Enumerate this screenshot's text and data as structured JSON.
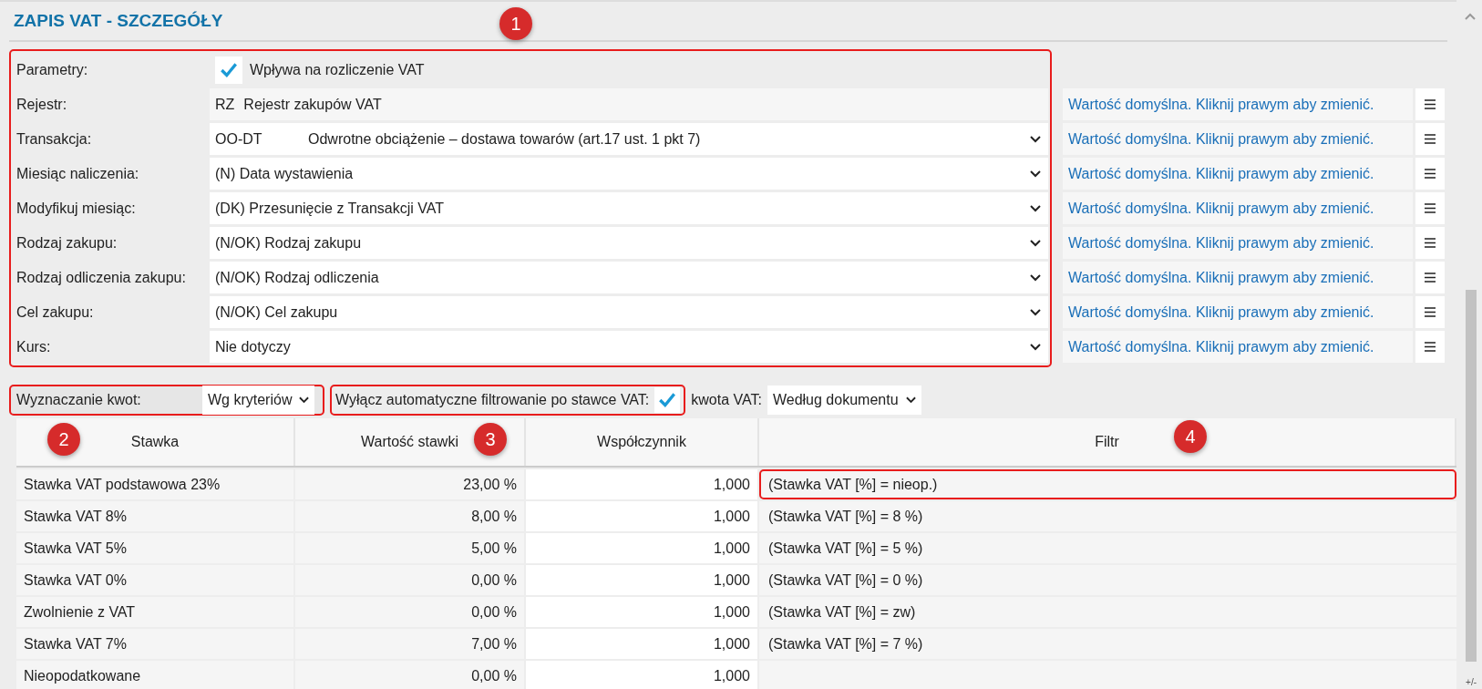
{
  "title": "ZAPIS VAT - SZCZEGÓŁY",
  "form": {
    "highlighted": true,
    "badge": "1",
    "rows": [
      {
        "kind": "checkbox",
        "label": "Parametry:",
        "checked": true,
        "text": "Wpływa na rozliczenie VAT"
      },
      {
        "kind": "static",
        "label": "Rejestr:",
        "code": "RZ",
        "text": "Rejestr zakupów VAT",
        "hint": "Wartość domyślna. Kliknij prawym aby zmienić."
      },
      {
        "kind": "select",
        "label": "Transakcja:",
        "code": "OO-DT",
        "text": "Odwrotne obciążenie – dostawa towarów (art.17 ust. 1 pkt 7)",
        "hint": "Wartość domyślna. Kliknij prawym aby zmienić."
      },
      {
        "kind": "select",
        "label": "Miesiąc naliczenia:",
        "text": "(N) Data wystawienia",
        "hint": "Wartość domyślna. Kliknij prawym aby zmienić."
      },
      {
        "kind": "select",
        "label": "Modyfikuj miesiąc:",
        "text": "(DK) Przesunięcie z Transakcji VAT",
        "hint": "Wartość domyślna. Kliknij prawym aby zmienić."
      },
      {
        "kind": "select",
        "label": "Rodzaj zakupu:",
        "text": "(N/OK) Rodzaj zakupu",
        "hint": "Wartość domyślna. Kliknij prawym aby zmienić."
      },
      {
        "kind": "select",
        "label": "Rodzaj odliczenia zakupu:",
        "text": "(N/OK) Rodzaj odliczenia",
        "hint": "Wartość domyślna. Kliknij prawym aby zmienić."
      },
      {
        "kind": "select",
        "label": "Cel zakupu:",
        "text": "(N/OK) Cel zakupu",
        "hint": "Wartość domyślna. Kliknij prawym aby zmienić."
      },
      {
        "kind": "select",
        "label": "Kurs:",
        "text": "Nie dotyczy",
        "hint": "Wartość domyślna. Kliknij prawym aby zmienić."
      }
    ]
  },
  "amounts": {
    "label": "Wyznaczanie kwot:",
    "value": "Wg kryteriów",
    "highlighted": true,
    "badge": "2"
  },
  "auto_filter": {
    "label": "Wyłącz automatyczne filtrowanie po stawce VAT:",
    "checked": true,
    "highlighted": true,
    "badge": "3"
  },
  "vat_amount": {
    "label": "kwota VAT:",
    "value": "Według dokumentu"
  },
  "table": {
    "columns": [
      "Stawka",
      "Wartość stawki",
      "Współczynnik",
      "Filtr"
    ],
    "badge": "4",
    "rows": [
      {
        "name": "Stawka VAT podstawowa 23%",
        "value": "23,00 %",
        "factor": "1,000",
        "filter": "(Stawka VAT [%] = nieop.)",
        "highlighted": true
      },
      {
        "name": "Stawka VAT 8%",
        "value": "8,00 %",
        "factor": "1,000",
        "filter": "(Stawka VAT [%] = 8 %)",
        "highlighted": false
      },
      {
        "name": "Stawka VAT 5%",
        "value": "5,00 %",
        "factor": "1,000",
        "filter": "(Stawka VAT [%] = 5 %)",
        "highlighted": false
      },
      {
        "name": "Stawka VAT 0%",
        "value": "0,00 %",
        "factor": "1,000",
        "filter": "(Stawka VAT [%] = 0 %)",
        "highlighted": false
      },
      {
        "name": "Zwolnienie z VAT",
        "value": "0,00 %",
        "factor": "1,000",
        "filter": "(Stawka VAT [%] = zw)",
        "highlighted": false
      },
      {
        "name": "Stawka VAT 7%",
        "value": "7,00 %",
        "factor": "1,000",
        "filter": "(Stawka VAT [%] = 7 %)",
        "highlighted": false
      },
      {
        "name": "Nieopodatkowane",
        "value": "0,00 %",
        "factor": "1,000",
        "highlighted": false
      }
    ]
  },
  "corner_label": "+/-"
}
